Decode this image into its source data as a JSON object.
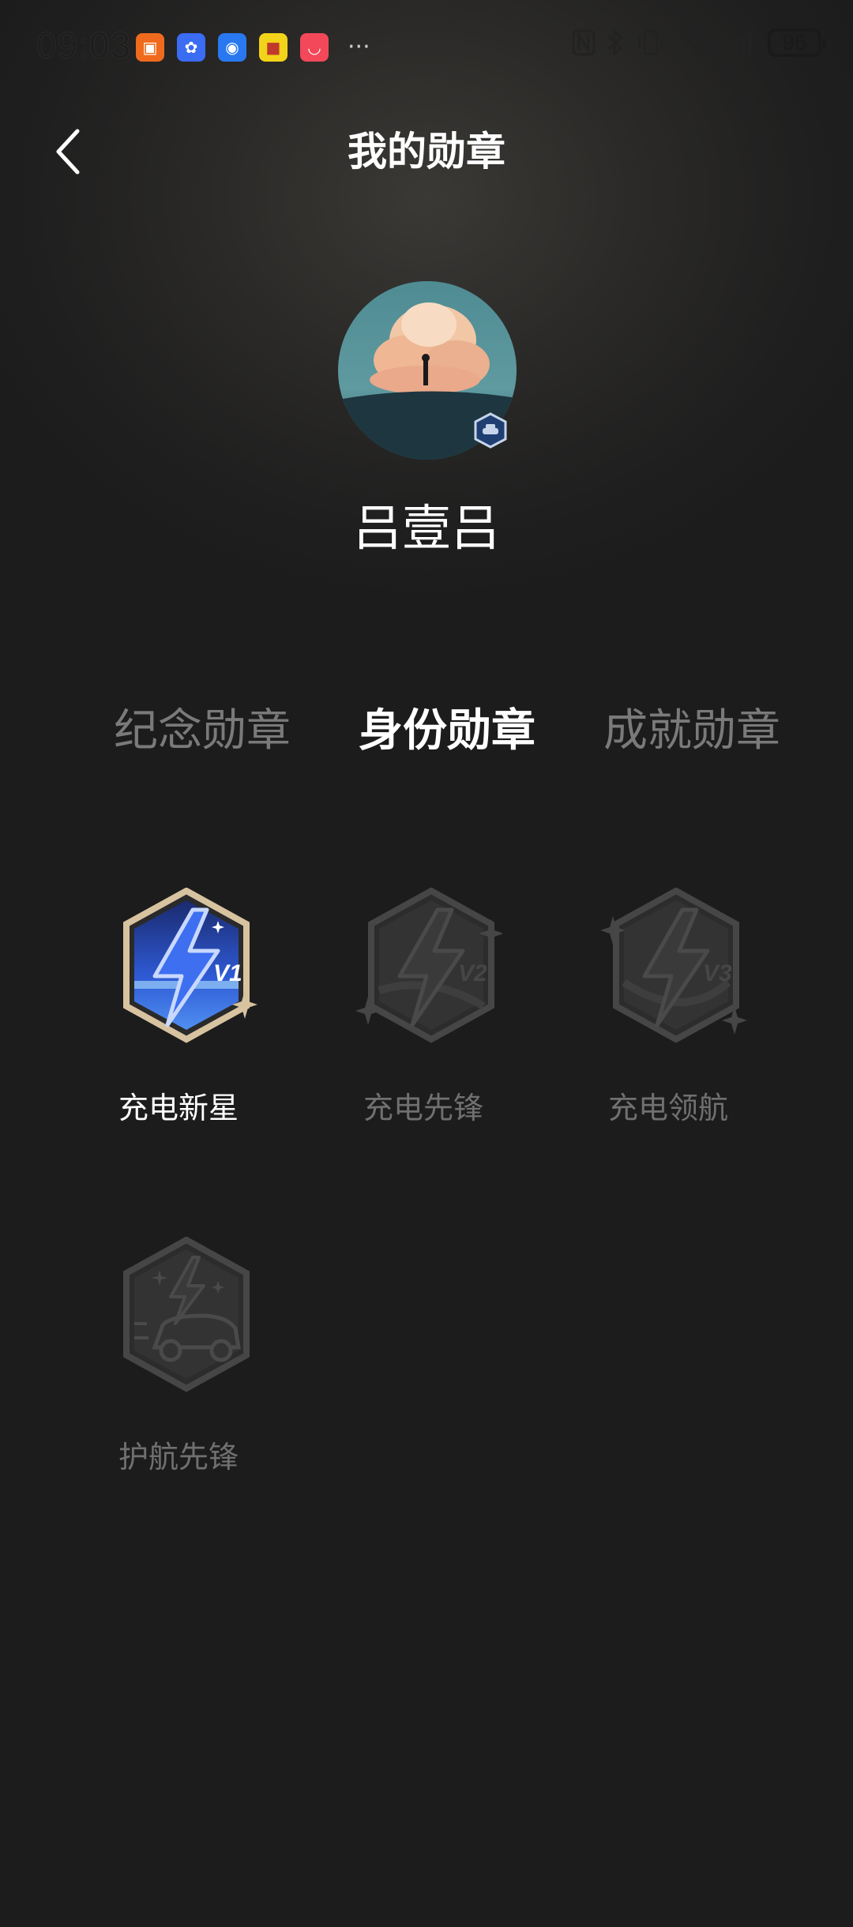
{
  "status_bar": {
    "time": "09:03",
    "battery": "96",
    "more": "···",
    "app_icons": [
      {
        "name": "orange-app-icon",
        "color": "#f06a1d"
      },
      {
        "name": "blue-flower-app-icon",
        "color": "#3a6cf4"
      },
      {
        "name": "lightbulb-app-icon",
        "color": "#2a78f0"
      },
      {
        "name": "yellow-app-icon",
        "color": "#f2d31a"
      },
      {
        "name": "huawei-store-app-icon",
        "color": "#f2485a"
      }
    ]
  },
  "header": {
    "title": "我的勋章"
  },
  "profile": {
    "username": "吕壹吕"
  },
  "tabs": [
    {
      "label": "纪念勋章",
      "active": false
    },
    {
      "label": "身份勋章",
      "active": true
    },
    {
      "label": "成就勋章",
      "active": false
    }
  ],
  "badges": [
    {
      "label": "充电新星",
      "level": "V1",
      "owned": true
    },
    {
      "label": "充电先锋",
      "level": "V2",
      "owned": false
    },
    {
      "label": "充电领航",
      "level": "V3",
      "owned": false
    },
    {
      "label": "护航先锋",
      "level": "",
      "owned": false
    }
  ],
  "colors": {
    "background": "#1c1c1c",
    "active_tab": "#ffffff",
    "inactive_tab": "#7a7a7a",
    "badge_blue": "#2f5bd6",
    "badge_gold": "#d8c3a0"
  }
}
